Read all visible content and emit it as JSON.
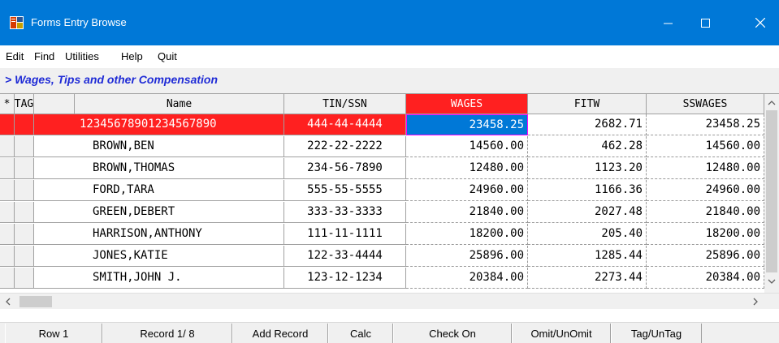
{
  "window": {
    "title": "Forms Entry Browse"
  },
  "menu": [
    "Edit",
    "Find",
    "Utilities",
    "Help",
    "Quit"
  ],
  "section_label": "> Wages, Tips and other Compensation",
  "columns": [
    "*",
    "TAG",
    "Name",
    "TIN/SSN",
    "WAGES",
    "FITW",
    "SSWAGES"
  ],
  "active_column": "WAGES",
  "rows": [
    {
      "name": "12345678901234567890",
      "tin": "444-44-4444",
      "wages": "23458.25",
      "fitw": "2682.71",
      "sswages": "23458.25"
    },
    {
      "name": "BROWN,BEN",
      "tin": "222-22-2222",
      "wages": "14560.00",
      "fitw": "462.28",
      "sswages": "14560.00"
    },
    {
      "name": "BROWN,THOMAS",
      "tin": "234-56-7890",
      "wages": "12480.00",
      "fitw": "1123.20",
      "sswages": "12480.00"
    },
    {
      "name": "FORD,TARA",
      "tin": "555-55-5555",
      "wages": "24960.00",
      "fitw": "1166.36",
      "sswages": "24960.00"
    },
    {
      "name": "GREEN,DEBERT",
      "tin": "333-33-3333",
      "wages": "21840.00",
      "fitw": "2027.48",
      "sswages": "21840.00"
    },
    {
      "name": "HARRISON,ANTHONY",
      "tin": "111-11-1111",
      "wages": "18200.00",
      "fitw": "205.40",
      "sswages": "18200.00"
    },
    {
      "name": "JONES,KATIE",
      "tin": "122-33-4444",
      "wages": "25896.00",
      "fitw": "1285.44",
      "sswages": "25896.00"
    },
    {
      "name": "SMITH,JOHN J.",
      "tin": "123-12-1234",
      "wages": "20384.00",
      "fitw": "2273.44",
      "sswages": "20384.00"
    }
  ],
  "status": {
    "row": "Row  1",
    "record": "Record  1/ 8",
    "add_record": "Add Record",
    "calc": "Calc",
    "check_on": "Check On",
    "omit": "Omit/UnOmit",
    "tag": "Tag/UnTag"
  },
  "icons": {
    "app": "forms-app-icon",
    "minimize": "minimize-icon",
    "maximize": "maximize-icon",
    "close": "close-icon",
    "scroll_up": "chevron-up-icon",
    "scroll_down": "chevron-down-icon",
    "scroll_left": "chevron-left-icon",
    "scroll_right": "chevron-right-icon"
  },
  "colors": {
    "titlebar": "#0078d7",
    "active_header": "#ff2020",
    "selected_row": "#ff2020",
    "selected_cell": "#0078d7",
    "section_label": "#1f2bd6"
  }
}
